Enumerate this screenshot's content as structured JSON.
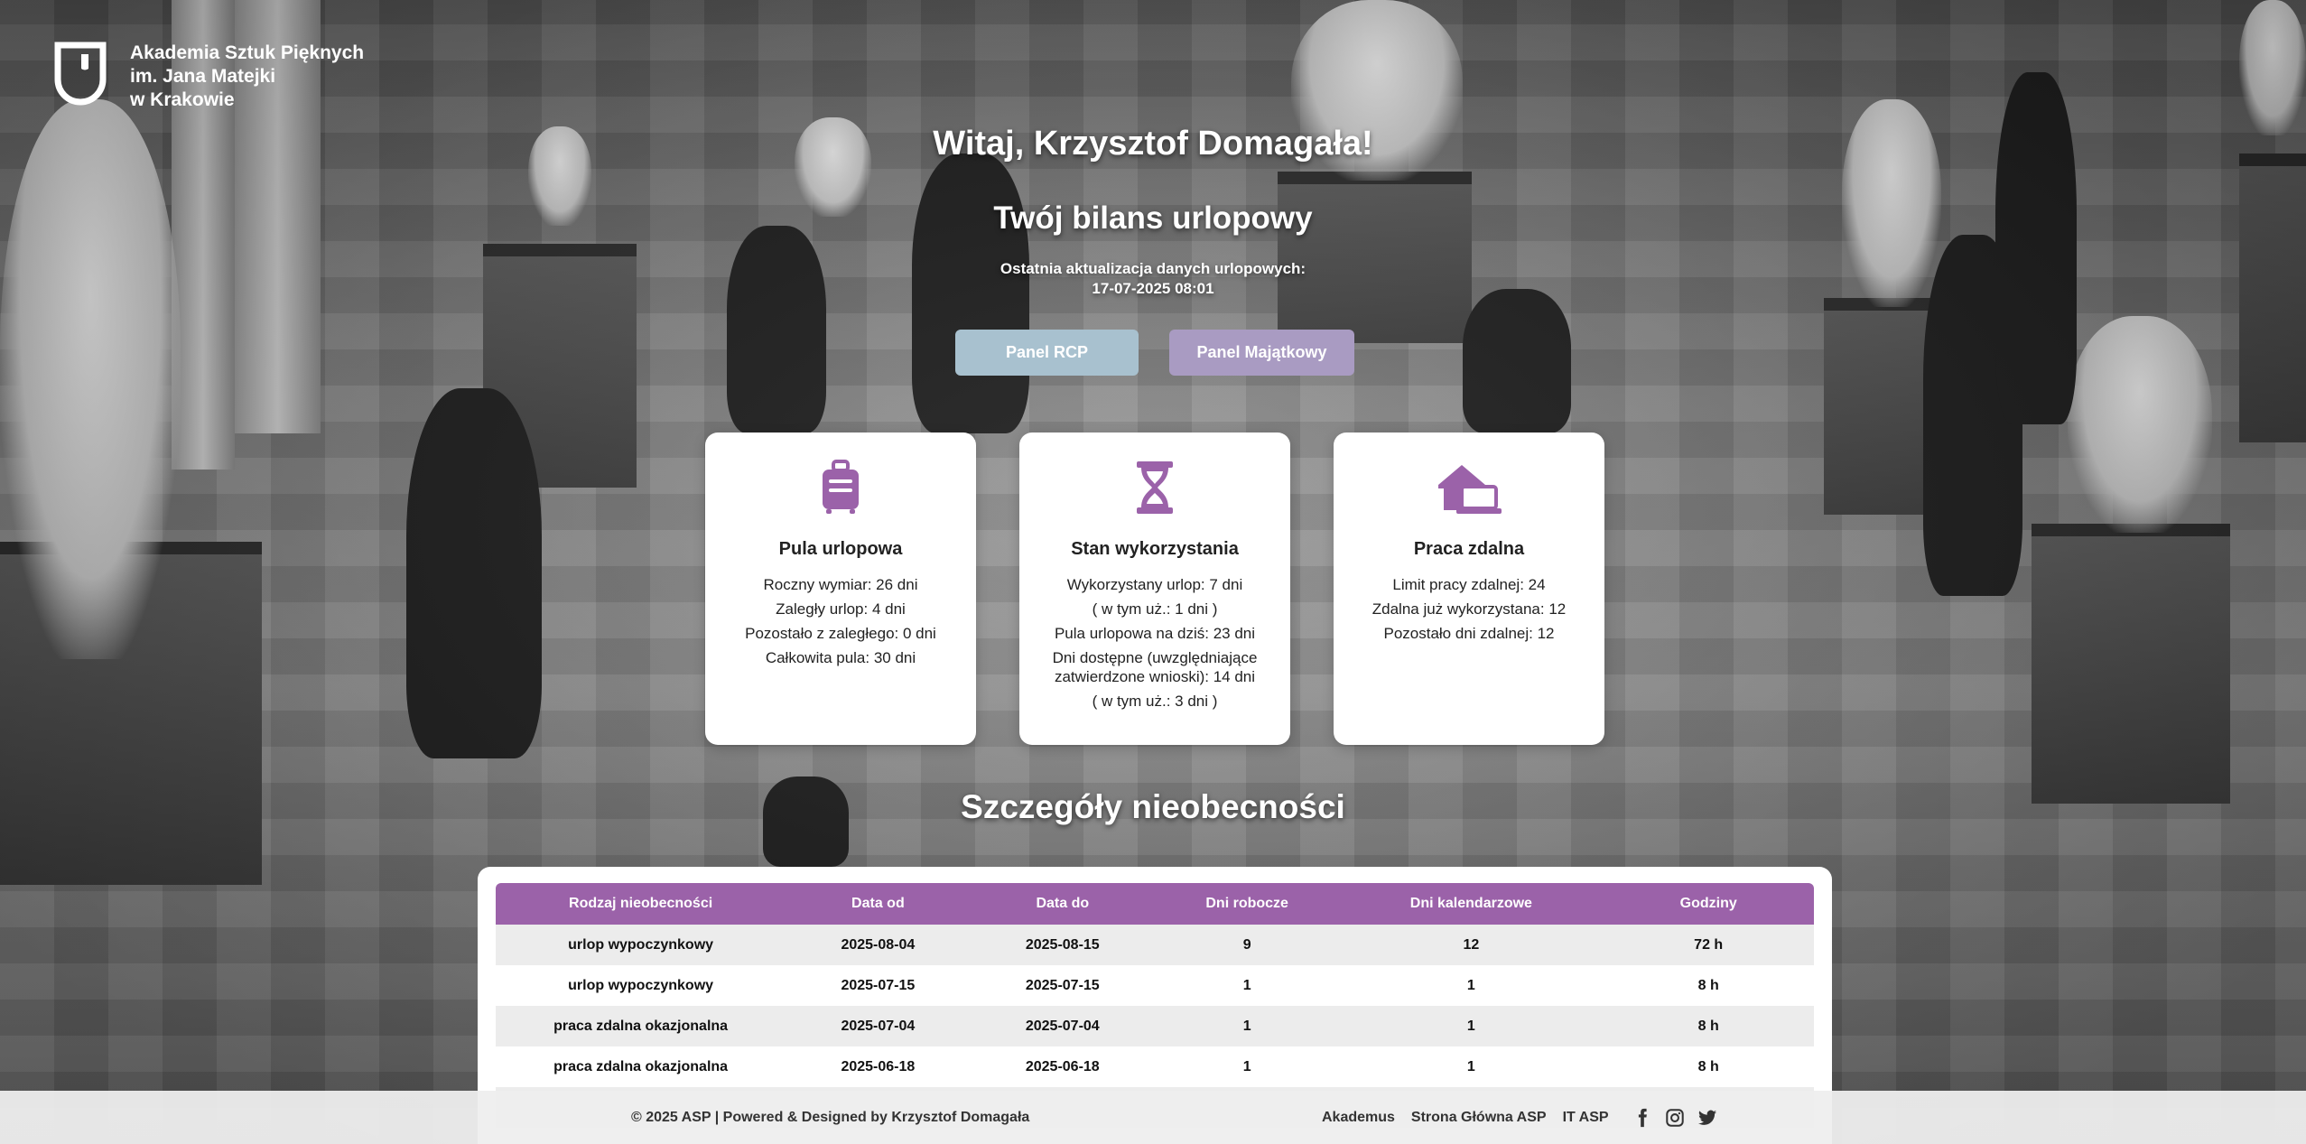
{
  "brand": {
    "line1": "Akademia Sztuk Pięknych",
    "line2": "im. Jana Matejki",
    "line3": "w Krakowie"
  },
  "header": {
    "welcome": "Witaj, Krzysztof Domagała!",
    "balance_title": "Twój bilans urlopowy",
    "update_label": "Ostatnia aktualizacja danych urlopowych:",
    "update_value": "17-07-2025 08:01"
  },
  "buttons": {
    "rcp": "Panel RCP",
    "majatkowy": "Panel Majątkowy"
  },
  "cards": {
    "pool": {
      "icon": "suitcase-icon",
      "title": "Pula urlopowa",
      "lines": [
        "Roczny wymiar: 26 dni",
        "Zaległy urlop: 4 dni",
        "Pozostało z zaległego: 0 dni",
        "Całkowita pula: 30 dni"
      ]
    },
    "usage": {
      "icon": "hourglass-icon",
      "title": "Stan wykorzystania",
      "lines": [
        "Wykorzystany urlop: 7 dni",
        "( w tym uż.: 1 dni )",
        "Pula urlopowa na dziś: 23 dni",
        "Dni dostępne (uwzględniające zatwierdzone wnioski): 14 dni",
        "( w tym uż.: 3 dni )"
      ]
    },
    "remote": {
      "icon": "home-laptop-icon",
      "title": "Praca zdalna",
      "lines": [
        "Limit pracy zdalnej: 24",
        "Zdalna już wykorzystana: 12",
        "Pozostało dni zdalnej: 12"
      ]
    }
  },
  "details": {
    "title": "Szczegóły nieobecności",
    "columns": [
      "Rodzaj nieobecności",
      "Data od",
      "Data do",
      "Dni robocze",
      "Dni kalendarzowe",
      "Godziny"
    ],
    "rows": [
      [
        "urlop wypoczynkowy",
        "2025-08-04",
        "2025-08-15",
        "9",
        "12",
        "72 h"
      ],
      [
        "urlop wypoczynkowy",
        "2025-07-15",
        "2025-07-15",
        "1",
        "1",
        "8 h"
      ],
      [
        "praca zdalna okazjonalna",
        "2025-07-04",
        "2025-07-04",
        "1",
        "1",
        "8 h"
      ],
      [
        "praca zdalna okazjonalna",
        "2025-06-18",
        "2025-06-18",
        "1",
        "1",
        "8 h"
      ],
      [
        "",
        "",
        "",
        "",
        "",
        ""
      ]
    ]
  },
  "footer": {
    "copyright": "© 2025 ASP | Powered & Designed by Krzysztof Domagała",
    "links": [
      "Akademus",
      "Strona Główna ASP",
      "IT ASP"
    ],
    "social": [
      "facebook-icon",
      "instagram-icon",
      "twitter-icon"
    ]
  },
  "colors": {
    "accent": "#9b62a9",
    "btn_rcp": "#a8c1cf",
    "btn_majatkowy": "#a99bc2"
  }
}
